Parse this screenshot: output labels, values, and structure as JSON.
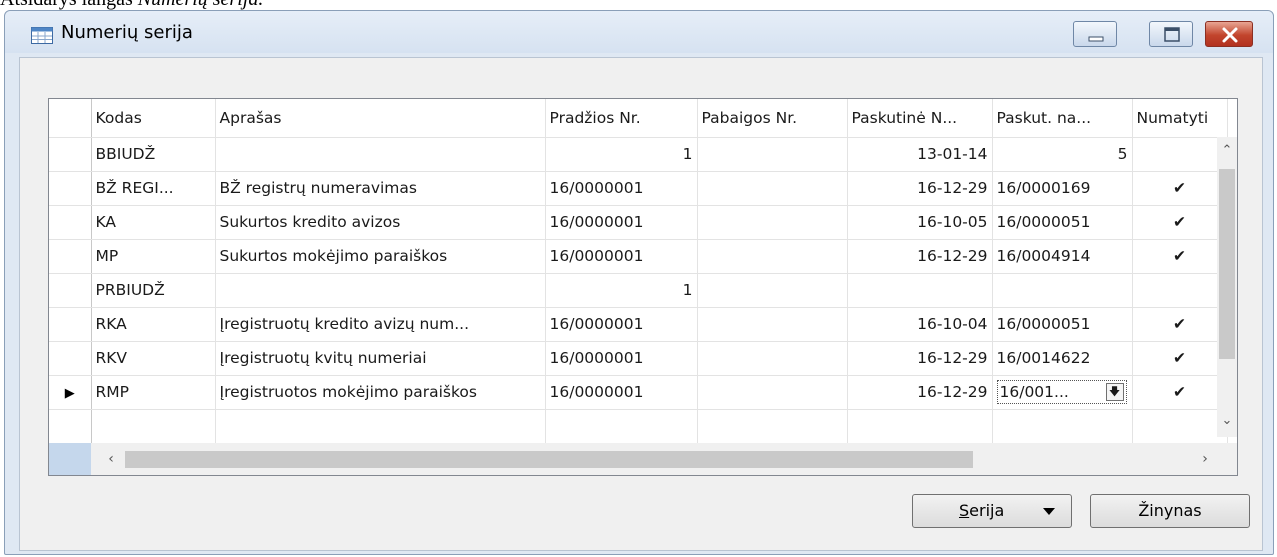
{
  "caption": {
    "prefix": "Atsidarys langas ",
    "emph": "Numerių serija."
  },
  "window": {
    "title": "Numerių serija"
  },
  "grid": {
    "columns": [
      "Kodas",
      "Aprašas",
      "Pradžios Nr.",
      "Pabaigos Nr.",
      "Paskutinė N...",
      "Paskut. na...",
      "Numatyti"
    ],
    "rows": [
      {
        "marker": "",
        "kodas": "BBIUDŽ",
        "aprasas": "",
        "pradzios": "1",
        "pabaigos": "",
        "data": "13-01-14",
        "paskut": "5",
        "numatyti": ""
      },
      {
        "marker": "",
        "kodas": "BŽ REGI...",
        "aprasas": "BŽ registrų numeravimas",
        "pradzios": "16/0000001",
        "pabaigos": "",
        "data": "16-12-29",
        "paskut": "16/0000169",
        "numatyti": "✔"
      },
      {
        "marker": "",
        "kodas": "KA",
        "aprasas": "Sukurtos kredito avizos",
        "pradzios": "16/0000001",
        "pabaigos": "",
        "data": "16-10-05",
        "paskut": "16/0000051",
        "numatyti": "✔"
      },
      {
        "marker": "",
        "kodas": "MP",
        "aprasas": "Sukurtos mokėjimo paraiškos",
        "pradzios": "16/0000001",
        "pabaigos": "",
        "data": "16-12-29",
        "paskut": "16/0004914",
        "numatyti": "✔"
      },
      {
        "marker": "",
        "kodas": "PRBIUDŽ",
        "aprasas": "",
        "pradzios": "1",
        "pabaigos": "",
        "data": "",
        "paskut": "",
        "numatyti": ""
      },
      {
        "marker": "",
        "kodas": "RKA",
        "aprasas": "Įregistruotų kredito avizų num...",
        "pradzios": "16/0000001",
        "pabaigos": "",
        "data": "16-10-04",
        "paskut": "16/0000051",
        "numatyti": "✔"
      },
      {
        "marker": "",
        "kodas": "RKV",
        "aprasas": "Įregistruotų kvitų numeriai",
        "pradzios": "16/0000001",
        "pabaigos": "",
        "data": "16-12-29",
        "paskut": "16/0014622",
        "numatyti": "✔"
      },
      {
        "marker": "▶",
        "kodas": "RMP",
        "aprasas": "Įregistruotos mokėjimo paraiškos",
        "pradzios": "16/0000001",
        "pabaigos": "",
        "data": "16-12-29",
        "paskut": "16/001...",
        "numatyti": "✔"
      }
    ]
  },
  "buttons": {
    "serija_first": "S",
    "serija_rest": "erija",
    "zinynas": "Žinynas"
  },
  "icons": {
    "title": "table-icon",
    "minimize": "minimize-icon",
    "maximize": "maximize-icon",
    "close": "close-icon",
    "dropdown": "arrow-down-icon"
  },
  "colors": {
    "close_button": "#c2452d",
    "selector_corner": "#c5d7ec"
  }
}
